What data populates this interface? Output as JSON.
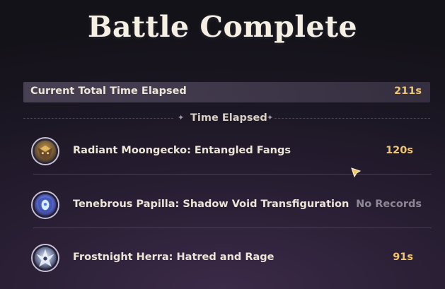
{
  "title": "Battle Complete",
  "total": {
    "label": "Current Total Time Elapsed",
    "value": "211s"
  },
  "section": {
    "title": "Time Elapsed"
  },
  "rows": [
    {
      "name": "Radiant Moongecko: Entangled Fangs",
      "time": "120s",
      "icon": "moongecko-icon"
    },
    {
      "name": "Tenebrous Papilla: Shadow Void Transfiguration",
      "time": "No Records",
      "icon": "papilla-icon"
    },
    {
      "name": "Frostnight Herra: Hatred and Rage",
      "time": "91s",
      "icon": "herra-icon"
    }
  ],
  "colors": {
    "accent_gold": "#f3c56a",
    "muted": "#8d8894",
    "text": "#ece5d8"
  }
}
